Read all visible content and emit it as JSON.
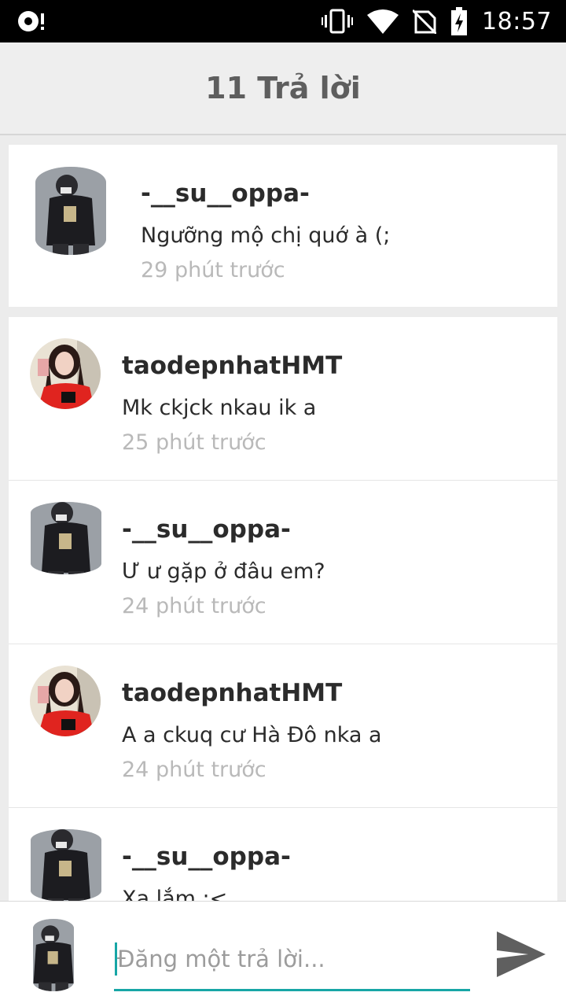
{
  "status_bar": {
    "time": "18:57",
    "icons": [
      "record-icon",
      "vibrate-icon",
      "wifi-icon",
      "no-sim-icon",
      "battery-charging-icon"
    ]
  },
  "header": {
    "title": "11 Trả lời"
  },
  "root_comment": {
    "username": "-__su__oppa-",
    "message": "Ngưỡng mộ chị quớ à (;",
    "time_ago": "29 phút trước"
  },
  "replies": [
    {
      "username": "taodepnhatHMT",
      "message": "Mk ckjck nkau ik a",
      "time_ago": "25 phút trước"
    },
    {
      "username": "-__su__oppa-",
      "message": "Ư ư gặp ở đâu em?",
      "time_ago": "24 phút trước"
    },
    {
      "username": "taodepnhatHMT",
      "message": "A a ckuq cư Hà Đô nka a",
      "time_ago": "24 phút trước"
    },
    {
      "username": "-__su__oppa-",
      "message": "Xa lắm :<",
      "time_ago": ""
    }
  ],
  "compose": {
    "placeholder": "Đăng một trả lời...",
    "value": "",
    "accent_color": "#17a6a6",
    "send_icon": "send-icon"
  }
}
